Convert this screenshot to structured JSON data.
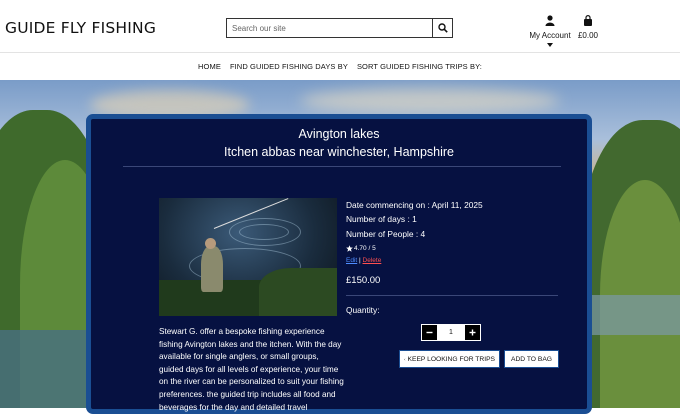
{
  "header": {
    "brand": "GUIDE FLY FISHING",
    "search": {
      "placeholder": "Search our site",
      "icon": "search-icon"
    },
    "account": {
      "label": "My Account",
      "icon": "user-icon"
    },
    "bag": {
      "total": "£0.00",
      "icon": "shopping-bag-icon"
    }
  },
  "nav": {
    "items": [
      {
        "label": "HOME"
      },
      {
        "label": "FIND GUIDED FISHING DAYS BY"
      },
      {
        "label": "SORT GUIDED FISHING TRIPS BY:"
      }
    ]
  },
  "product": {
    "title": "Avington lakes",
    "subtitle": "Itchen abbas near winchester, Hampshire",
    "date": "Date commencing on : April 11, 2025",
    "days": "Number of days : 1",
    "people": "Number of People : 4",
    "rating": "4.70 / 5",
    "edit_label": "Edit",
    "separator": "|",
    "delete_label": "Delete",
    "price": "£150.00",
    "quantity_label": "Quantity:",
    "quantity_value": "1",
    "description": "Stewart G. offer a bespoke fishing experience fishing Avington lakes and the itchen. With the day available for single anglers, or small groups, guided days for all levels of experience, your time on the river can be personalized to suit your fishing preferences. the guided trip includes all food and beverages for the day and detailed travel"
  },
  "buttons": {
    "keep_looking": "KEEP LOOKING FOR TRIPS",
    "add_to_bag": "ADD TO BAG"
  },
  "colors": {
    "card_background": "#061141",
    "card_border": "#1a4e93",
    "edit_link": "#4f8dff",
    "delete_link": "#ff4f4f"
  }
}
